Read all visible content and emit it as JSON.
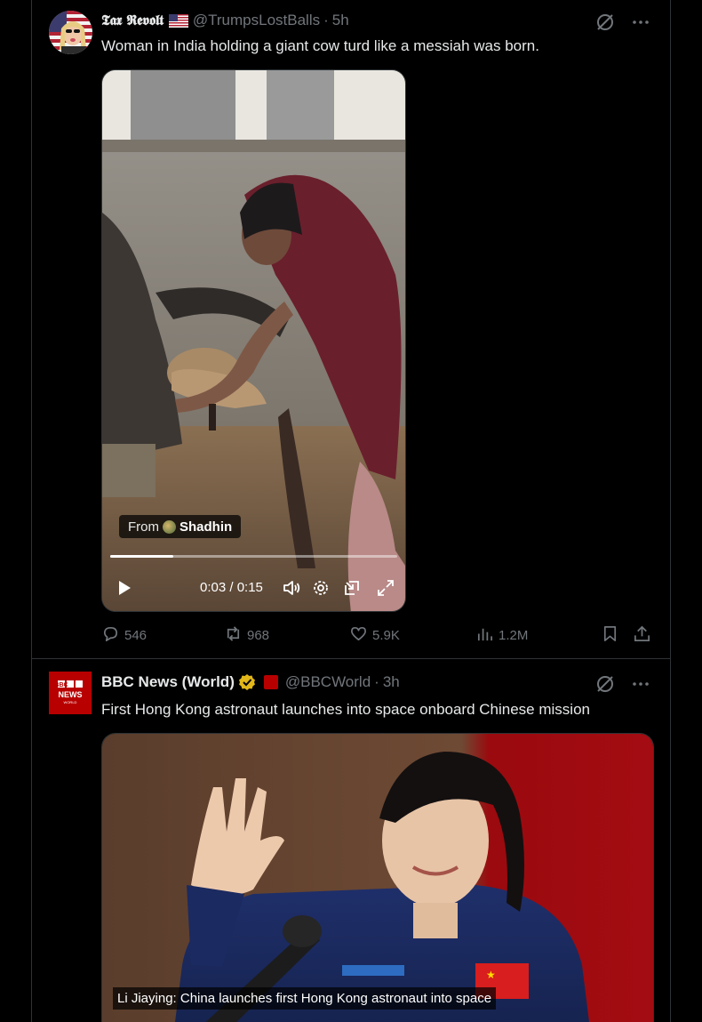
{
  "tweets": [
    {
      "display_name": "𝕿𝖆𝖝 𝕽𝖊𝖛𝖔𝖑𝖙",
      "handle": "@TrumpsLostBalls",
      "time": "5h",
      "text": "Woman in India holding a giant cow turd like a messiah was born.",
      "video": {
        "from_label": "From",
        "from_source": "Shadhin",
        "timecode": "0:03 / 0:15",
        "progress": 0.22
      },
      "stats": {
        "replies": "546",
        "reposts": "968",
        "likes": "5.9K",
        "views": "1.2M"
      }
    },
    {
      "display_name": "BBC News (World)",
      "handle": "@BBCWorld",
      "time": "3h",
      "text": "First Hong Kong astronaut launches into space onboard Chinese mission",
      "avatar_text": [
        "BBC",
        "NEWS",
        "WORLD"
      ],
      "caption": "Li Jiaying: China launches first Hong Kong astronaut into space"
    }
  ],
  "colors": {
    "background": "#000000",
    "text_primary": "#e7e9ea",
    "text_secondary": "#71767b",
    "border": "#2f3336",
    "bbc_red": "#b80000",
    "verified_gold": "#e2b719"
  },
  "icons": [
    "grok-icon",
    "more-icon",
    "reply-icon",
    "repost-icon",
    "like-icon",
    "views-icon",
    "bookmark-icon",
    "share-icon",
    "play-icon",
    "volume-icon",
    "settings-icon",
    "dock-icon",
    "fullscreen-icon",
    "verified-badge-icon",
    "us-flag-icon"
  ]
}
